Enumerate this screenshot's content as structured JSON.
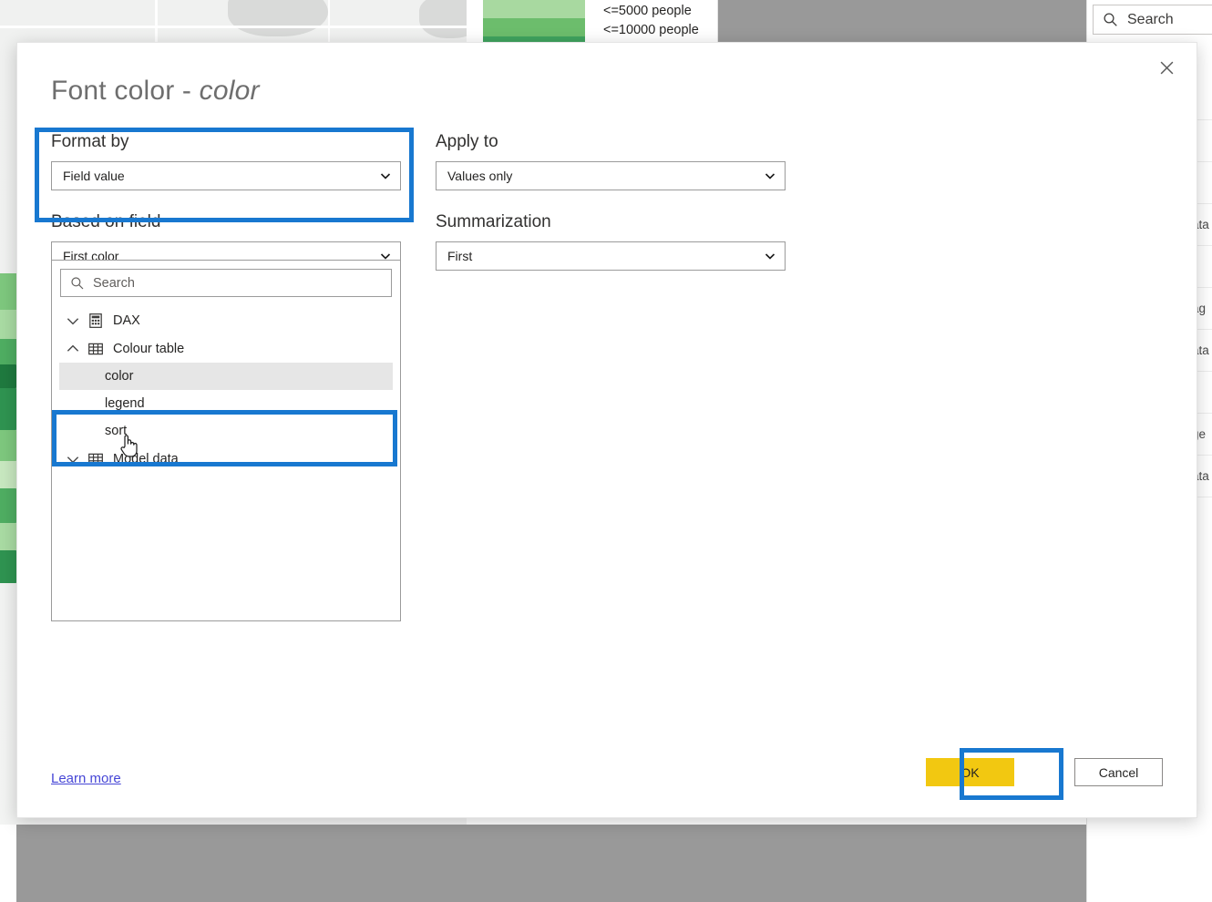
{
  "background": {
    "legend": {
      "swatch_colors": [
        "#a8d9a0",
        "#6cbd6c",
        "#3fa35e"
      ],
      "labels": [
        "<=5000 people",
        "<=10000 people"
      ]
    },
    "search": {
      "placeholder": "Search",
      "icon": "search-icon"
    },
    "side_rows": [
      "",
      "",
      "",
      "ata",
      "",
      "ag",
      "ata",
      "",
      "ge",
      "ata"
    ],
    "overlay_color": "#999999",
    "map_greens": [
      "#7ec87e",
      "#4fae62",
      "#1f7a3f",
      "#a9dba3",
      "#2f9451",
      "#c8e8c0"
    ]
  },
  "dialog": {
    "title_main": "Font color - ",
    "title_em": "color",
    "close_icon": "close-icon",
    "format_by": {
      "label": "Format by",
      "value": "Field value",
      "chevron": "chevron-down-icon"
    },
    "apply_to": {
      "label": "Apply to",
      "value": "Values only",
      "chevron": "chevron-down-icon"
    },
    "based_on_field": {
      "label": "Based on field",
      "value": "First color",
      "chevron": "chevron-down-icon"
    },
    "summarization": {
      "label": "Summarization",
      "value": "First",
      "chevron": "chevron-down-icon"
    },
    "field_tree": {
      "search_placeholder": "Search",
      "search_icon": "search-icon",
      "nodes": [
        {
          "label": "DAX",
          "icon": "calculator-icon",
          "state": "collapsed",
          "chevron": "chevron-down-icon",
          "children": []
        },
        {
          "label": "Colour table",
          "icon": "table-icon",
          "state": "expanded",
          "chevron": "chevron-up-icon",
          "children": [
            {
              "label": "color",
              "selected": true
            },
            {
              "label": "legend",
              "selected": false
            },
            {
              "label": "sort",
              "selected": false
            }
          ]
        },
        {
          "label": "Model data",
          "icon": "table-icon",
          "state": "collapsed",
          "chevron": "chevron-down-icon",
          "children": []
        }
      ]
    },
    "learn_more": "Learn more",
    "ok_button": "OK",
    "cancel_button": "Cancel",
    "highlight_color": "#1878D0",
    "ok_button_color": "#F2C811"
  }
}
